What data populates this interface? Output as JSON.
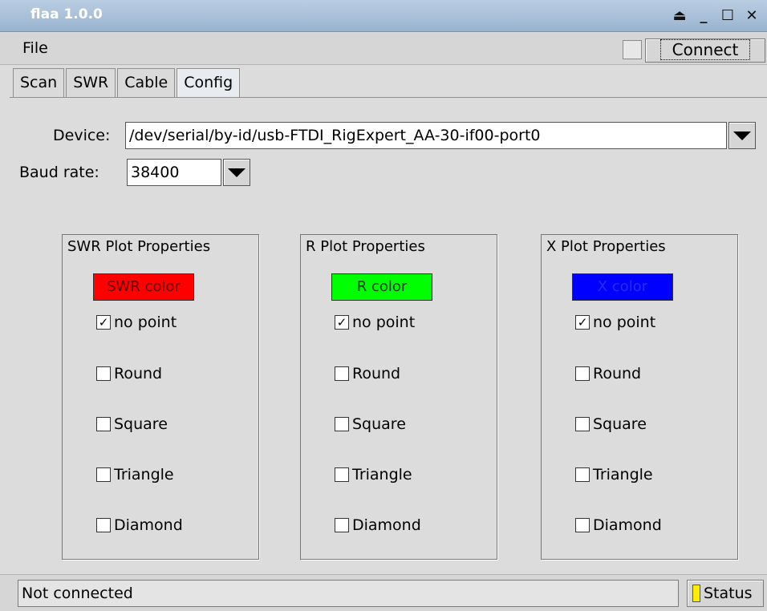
{
  "window": {
    "title": "flaa 1.0.0",
    "controls": [
      "⏏",
      "_",
      "☐",
      "✕"
    ]
  },
  "menu": {
    "file_label": "File"
  },
  "connect": {
    "label": "Connect",
    "checked": false
  },
  "tabs": [
    {
      "label": "Scan"
    },
    {
      "label": "SWR"
    },
    {
      "label": "Cable"
    },
    {
      "label": "Config",
      "active": true
    }
  ],
  "config": {
    "device_label": "Device:",
    "device_value": "/dev/serial/by-id/usb-FTDI_RigExpert_AA-30-if00-port0",
    "baud_label": "Baud rate:",
    "baud_value": "38400"
  },
  "groups": [
    {
      "title": "SWR Plot Properties",
      "color_label": "SWR color",
      "color": "#ff0000",
      "options": [
        {
          "label": "no point",
          "checked": true
        },
        {
          "label": "Round",
          "checked": false
        },
        {
          "label": "Square",
          "checked": false
        },
        {
          "label": "Triangle",
          "checked": false
        },
        {
          "label": "Diamond",
          "checked": false
        }
      ]
    },
    {
      "title": "R Plot Properties",
      "color_label": "R color",
      "color": "#00ff00",
      "options": [
        {
          "label": "no point",
          "checked": true
        },
        {
          "label": "Round",
          "checked": false
        },
        {
          "label": "Square",
          "checked": false
        },
        {
          "label": "Triangle",
          "checked": false
        },
        {
          "label": "Diamond",
          "checked": false
        }
      ]
    },
    {
      "title": "X Plot Properties",
      "color_label": "X color",
      "color": "#0000ff",
      "options": [
        {
          "label": "no point",
          "checked": true
        },
        {
          "label": "Round",
          "checked": false
        },
        {
          "label": "Square",
          "checked": false
        },
        {
          "label": "Triangle",
          "checked": false
        },
        {
          "label": "Diamond",
          "checked": false
        }
      ]
    }
  ],
  "status": {
    "text": "Not connected",
    "button_label": "Status",
    "led_color": "#ffee00"
  }
}
